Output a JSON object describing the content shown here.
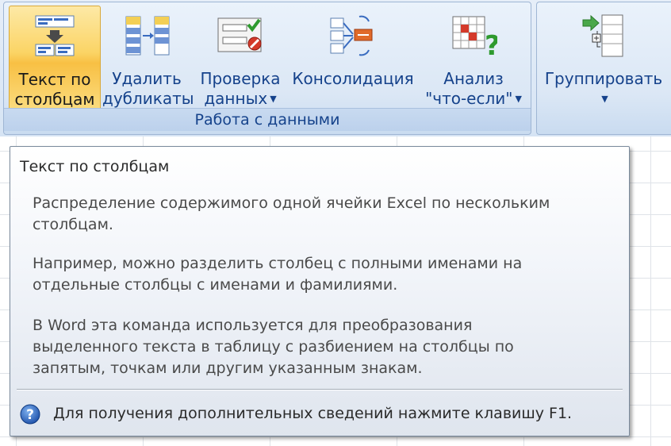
{
  "ribbon": {
    "data_group_label": "Работа с данными",
    "buttons": [
      {
        "line1": "Текст по",
        "line2": "столбцам",
        "icon": "text-to-columns-icon"
      },
      {
        "line1": "Удалить",
        "line2": "дубликаты",
        "icon": "remove-duplicates-icon"
      },
      {
        "line1": "Проверка",
        "line2": "данных",
        "icon": "data-validation-icon",
        "dropdown": "▼"
      },
      {
        "line1": "Консолидация",
        "line2": "",
        "icon": "consolidate-icon"
      },
      {
        "line1": "Анализ",
        "line2": "\"что-если\"",
        "icon": "what-if-icon",
        "dropdown": "▼"
      },
      {
        "line1": "Группировать",
        "line2": "",
        "icon": "group-icon",
        "dropdown": "▼"
      }
    ],
    "colors": {
      "active": "#fbd465",
      "text": "#15428b"
    }
  },
  "tooltip": {
    "title": "Текст по столбцам",
    "p1_l1": "Распределение содержимого одной ячейки Excel по нескольким",
    "p1_l2": "столбцам.",
    "p2_l1": "Например, можно разделить столбец с полными именами на",
    "p2_l2": "отдельные столбцы с именами и фамилиями.",
    "p3_l1": "В Word эта команда используется для преобразования",
    "p3_l2": "выделенного текста в таблицу с разбиением на столбцы по",
    "p3_l3": "запятым, точкам или другим указанным знакам.",
    "help_text": "Для получения дополнительных сведений нажмите клавишу F1.",
    "help_icon": "help-icon"
  }
}
